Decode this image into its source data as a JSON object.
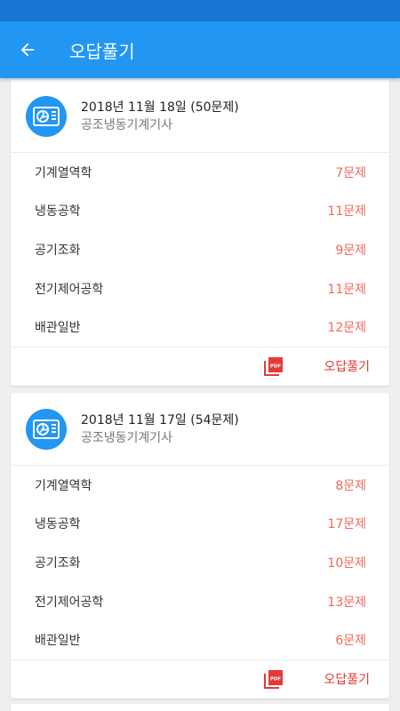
{
  "appbar": {
    "title": "오답풀기",
    "back_icon": "arrow-left-icon"
  },
  "colors": {
    "primary": "#2196f3",
    "statusbar": "#1976d2",
    "count": "#f0695c",
    "action": "#e53935"
  },
  "cards": [
    {
      "title": "2018년 11월 18일 (50문제)",
      "subtitle": "공조냉동기계기사",
      "icon": "air-conditioner-icon",
      "rows": [
        {
          "label": "기계열역학",
          "count": "7문제"
        },
        {
          "label": "냉동공학",
          "count": "11문제"
        },
        {
          "label": "공기조화",
          "count": "9문제"
        },
        {
          "label": "전기제어공학",
          "count": "11문제"
        },
        {
          "label": "배관일반",
          "count": "12문제"
        }
      ],
      "pdf_icon": "pdf-icon",
      "action_label": "오답풀기"
    },
    {
      "title": "2018년 11월 17일 (54문제)",
      "subtitle": "공조냉동기계기사",
      "icon": "air-conditioner-icon",
      "rows": [
        {
          "label": "기계열역학",
          "count": "8문제"
        },
        {
          "label": "냉동공학",
          "count": "17문제"
        },
        {
          "label": "공기조화",
          "count": "10문제"
        },
        {
          "label": "전기제어공학",
          "count": "13문제"
        },
        {
          "label": "배관일반",
          "count": "6문제"
        }
      ],
      "pdf_icon": "pdf-icon",
      "action_label": "오답풀기"
    }
  ]
}
